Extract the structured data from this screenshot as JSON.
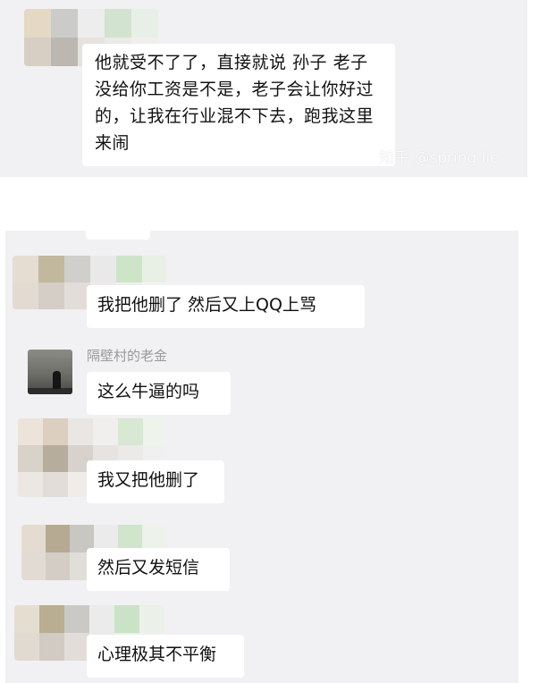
{
  "watermark": "知乎 @spring lie",
  "chat_top": {
    "message": "他就受不了了，直接就说 孙子 老子没给你工资是不是，老子会让你好过的，让我在行业混不下去，跑我这里来闹"
  },
  "chat_bottom": {
    "sender_name": "隔壁村的老金",
    "messages": [
      "我把他删了 然后又上QQ上骂",
      "这么牛逼的吗",
      "我又把他删了",
      "然后又发短信",
      "心理极其不平衡"
    ]
  },
  "colors": {
    "chat_background": "#f1f0f2",
    "bubble": "#ffffff",
    "sender_name": "#9a9a9a"
  }
}
